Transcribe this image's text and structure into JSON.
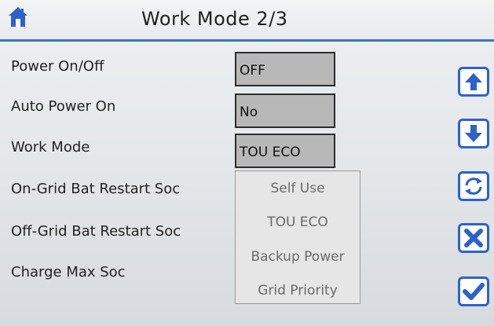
{
  "header": {
    "title": "Work Mode 2/3",
    "home_icon": "home-icon"
  },
  "rows": [
    {
      "label": "Power On/Off",
      "value": "OFF"
    },
    {
      "label": "Auto Power On",
      "value": "No"
    },
    {
      "label": "Work Mode",
      "value": "TOU ECO"
    },
    {
      "label": "On-Grid Bat Restart Soc"
    },
    {
      "label": "Off-Grid Bat Restart Soc"
    },
    {
      "label": "Charge Max Soc"
    }
  ],
  "work_mode_dropdown": {
    "options": [
      "Self Use",
      "TOU ECO",
      "Backup Power",
      "Grid Priority"
    ],
    "selected": "TOU ECO"
  },
  "side_buttons": [
    "arrow-up-icon",
    "arrow-down-icon",
    "refresh-icon",
    "cancel-icon",
    "confirm-icon"
  ],
  "colors": {
    "accent_blue": "#2f62c8",
    "value_box_bg": "#b8b8b8",
    "header_line": "#3d6fd6"
  }
}
